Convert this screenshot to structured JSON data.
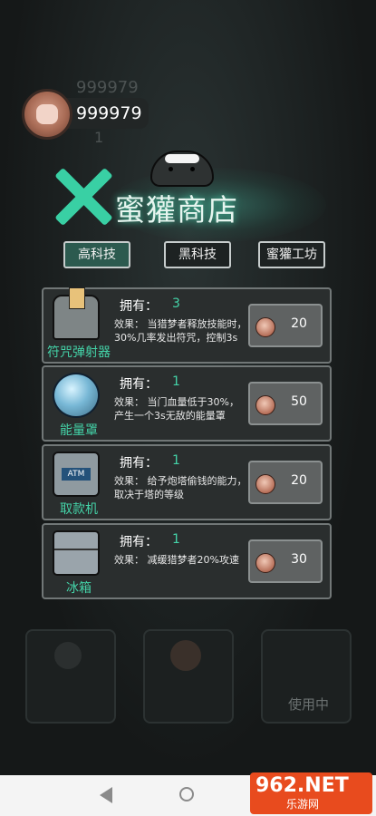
{
  "hud": {
    "coins": "999979",
    "ghost_coins": "999979",
    "ghost_count": "1"
  },
  "title": "蜜獾商店",
  "tabs": [
    {
      "label": "高科技",
      "active": true
    },
    {
      "label": "黑科技",
      "active": false
    },
    {
      "label": "蜜獾工坊",
      "active": false
    }
  ],
  "items": [
    {
      "name": "符咒弹射器",
      "own_label": "拥有：",
      "owned": "3",
      "effect": "效果：    当猎梦者释放技能时，30%几率发出符咒，控制3s",
      "price": "20",
      "icon": "talisman-launcher-icon"
    },
    {
      "name": "能量罩",
      "own_label": "拥有：",
      "owned": "1",
      "effect": "效果：    当门血量低于30%，产生一个3s无敌的能量罩",
      "price": "50",
      "icon": "energy-shield-icon"
    },
    {
      "name": "取款机",
      "own_label": "拥有：",
      "owned": "1",
      "effect": "效果：    给予炮塔偷钱的能力，取决于塔的等级",
      "price": "20",
      "icon": "atm-icon"
    },
    {
      "name": "冰箱",
      "own_label": "拥有：",
      "owned": "1",
      "effect": "效果：       减缓猎梦者20%攻速",
      "price": "30",
      "icon": "fridge-icon"
    }
  ],
  "background": {
    "in_use_label": "使用中"
  },
  "watermark": {
    "main": "962.NET",
    "sub": "乐游网"
  },
  "colors": {
    "accent": "#44d3a8",
    "tab_active": "#2c5a4f",
    "card_bg": "#2a2e2e"
  }
}
